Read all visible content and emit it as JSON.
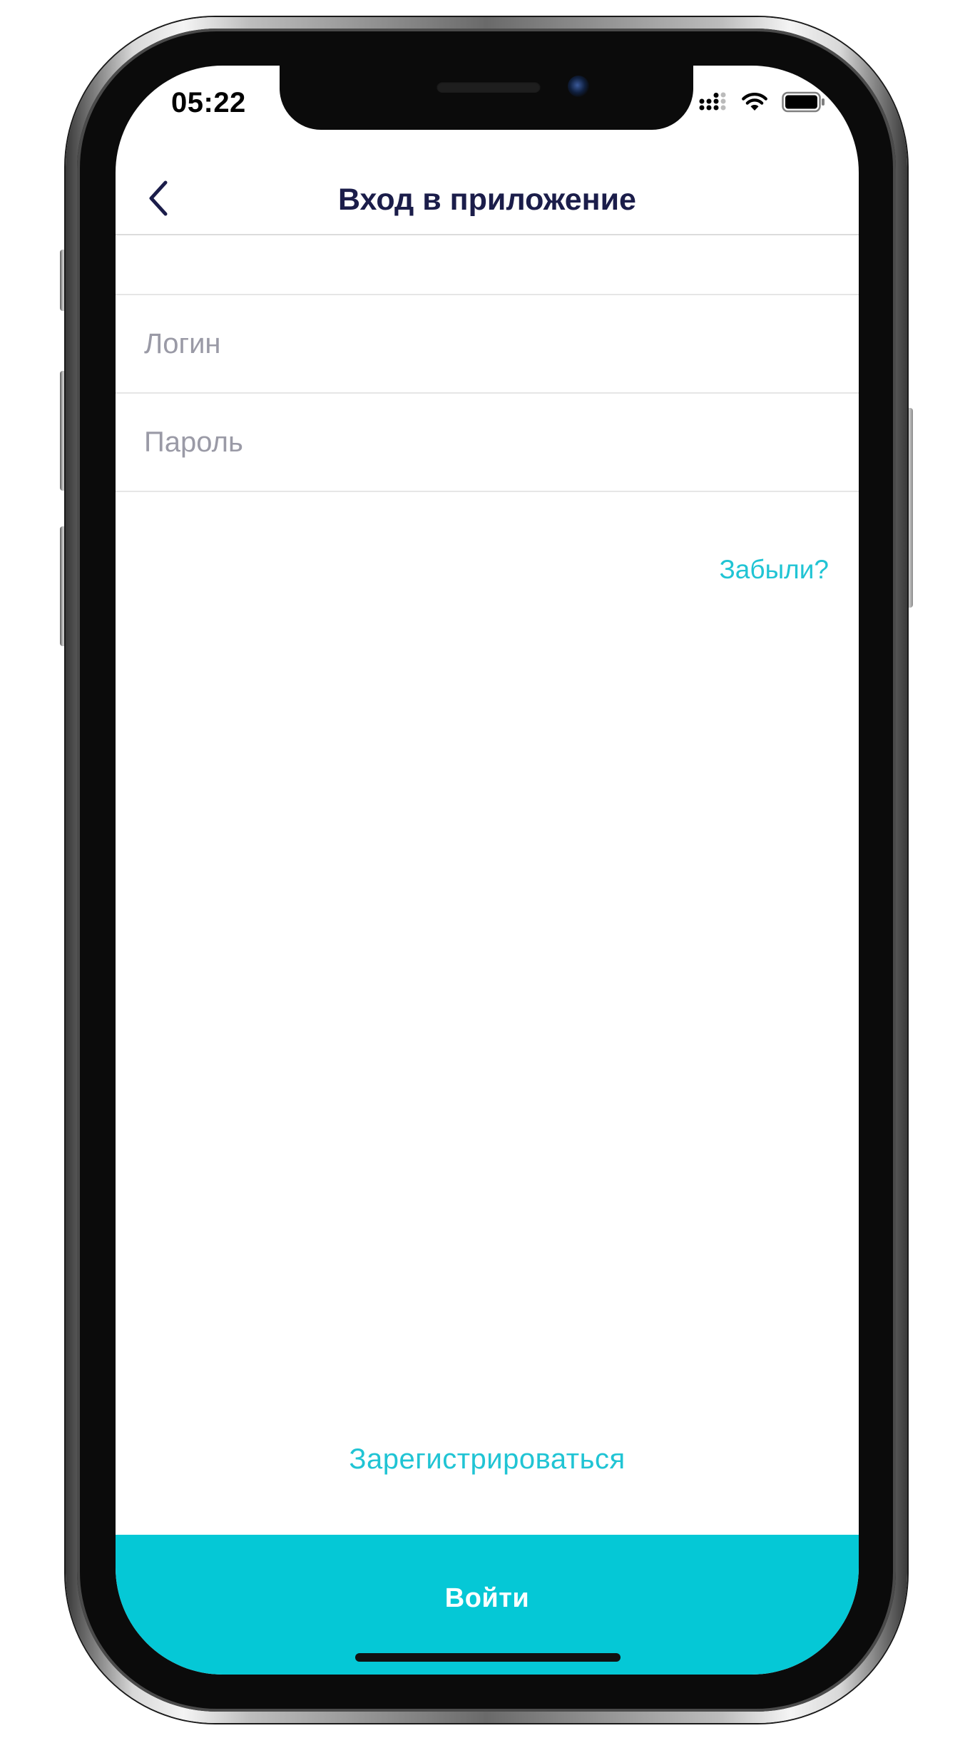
{
  "status_bar": {
    "time": "05:22",
    "signal_icon": "cellular-signal-icon",
    "wifi_icon": "wifi-icon",
    "battery_icon": "battery-icon"
  },
  "nav": {
    "back_icon": "chevron-left-icon",
    "title": "Вход в приложение"
  },
  "form": {
    "login_placeholder": "Логин",
    "login_value": "",
    "password_placeholder": "Пароль",
    "password_value": "",
    "forgot_label": "Забыли?"
  },
  "footer": {
    "register_label": "Зарегистрироваться",
    "login_button_label": "Войти"
  },
  "colors": {
    "accent": "#05c8d6",
    "link": "#20c4d4",
    "title": "#1b1d4a",
    "placeholder": "#9a9aa6",
    "divider": "#e6e6e6"
  }
}
